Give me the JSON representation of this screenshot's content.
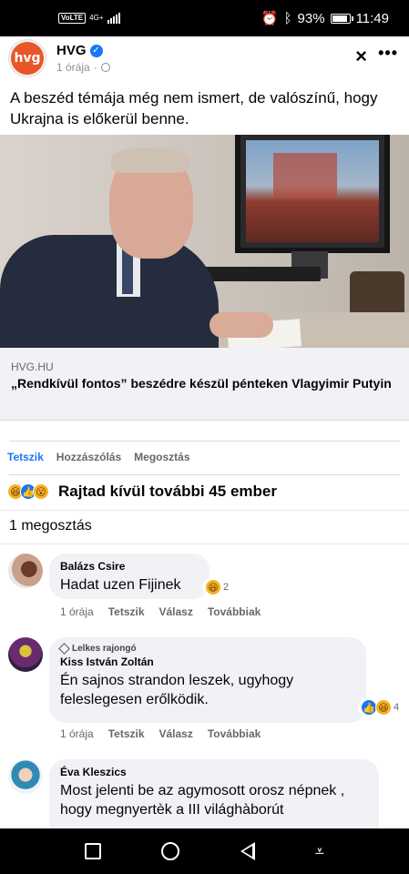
{
  "status_bar": {
    "volte": "VoLTE",
    "network": "4G+",
    "battery": "93%",
    "battery_level": 0.93,
    "time": "11:49"
  },
  "post": {
    "page_name": "HVG",
    "avatar_text": "hvg",
    "time": "1 órája",
    "time_separator": "·",
    "text": "A beszéd témája még nem ismert, de valószínű, hogy Ukrajna is előkerül benne.",
    "link": {
      "domain": "HVG.HU",
      "title": "„Rendkívül fontos” beszédre készül pénteken Vlagyimir Putyin"
    },
    "actions": [
      "Tetszik",
      "Hozzászólás",
      "Megosztás"
    ],
    "reactions_text": "Rajtad kívül további 45 ember",
    "shares_text": "1 megosztás"
  },
  "comments": [
    {
      "author": "Balázs Csire",
      "badge": "",
      "text": "Hadat uzen Fijinek",
      "reaction_count": "2",
      "time": "1 órája",
      "like": "Tetszik",
      "reply": "Válasz",
      "more": "Továbbiak"
    },
    {
      "author": "Kiss István Zoltán",
      "badge": "Lelkes rajongó",
      "text": "Én sajnos strandon leszek, ugyhogy feleslegesen erőlködik.",
      "reaction_count": "4",
      "time": "1 órája",
      "like": "Tetszik",
      "reply": "Válasz",
      "more": "Továbbiak"
    },
    {
      "author": "Éva Kleszics",
      "badge": "",
      "text": "Most jelenti be az agymosott orosz népnek , hogy megnyertèk a III világhàborút"
    }
  ],
  "icons": {
    "close": "×",
    "more": "•••",
    "verified": "✓",
    "nav_down": "⩡"
  },
  "colors": {
    "brand": "#1877f2",
    "hvg": "#e8562a"
  }
}
